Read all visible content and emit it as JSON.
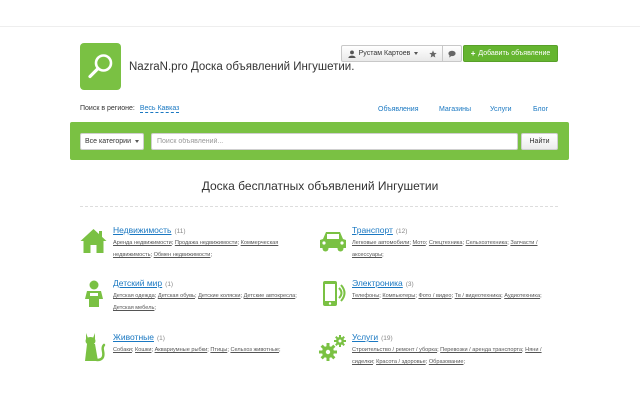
{
  "header": {
    "site_title": "NazraN.pro Доска объявлений Ингушетии.",
    "user_name": "Рустам Картоев",
    "add_label": "Добавить объявление",
    "region_label": "Поиск в регионе:",
    "region_value": "Весь Кавказ"
  },
  "nav": [
    "Объявления",
    "Магазины",
    "Услуги",
    "Блог"
  ],
  "search": {
    "category_label": "Все категории",
    "placeholder": "Поиск объявлений...",
    "button_label": "Найти"
  },
  "page_heading": "Доска бесплатных объявлений Ингушетии",
  "categories": [
    {
      "title": "Недвижимость",
      "count": "(11)",
      "icon": "house-icon",
      "subs": [
        "Аренда недвижимости",
        "Продажа недвижимости",
        "Коммерческая недвижимость",
        "Обмен недвижимости"
      ]
    },
    {
      "title": "Транспорт",
      "count": "(12)",
      "icon": "car-icon",
      "subs": [
        "Легковые автомобили",
        "Мото",
        "Спецтехника",
        "Сельхозтехника",
        "Запчасти / аксессуары"
      ]
    },
    {
      "title": "Детский мир",
      "count": "(1)",
      "icon": "child-icon",
      "subs": [
        "Детская одежда",
        "Детская обувь",
        "Детские коляски",
        "Детские автокресла",
        "Детская мебель"
      ]
    },
    {
      "title": "Электроника",
      "count": "(3)",
      "icon": "electronics-icon",
      "subs": [
        "Телефоны",
        "Компьютеры",
        "Фото / видео",
        "Тв / видеотехника",
        "Аудиотехника"
      ]
    },
    {
      "title": "Животные",
      "count": "(1)",
      "icon": "cat-icon",
      "subs": [
        "Собаки",
        "Кошки",
        "Аквариумные рыбки",
        "Птицы",
        "Сельхоз животные"
      ]
    },
    {
      "title": "Услуги",
      "count": "(19)",
      "icon": "gears-icon",
      "subs": [
        "Строительство / ремонт / уборка",
        "Перевозки / аренда транспорта",
        "Няни / сиделки",
        "Красота / здоровье",
        "Образование"
      ]
    }
  ],
  "colors": {
    "brand_green": "#7ac143",
    "link_blue": "#1a78c2"
  }
}
